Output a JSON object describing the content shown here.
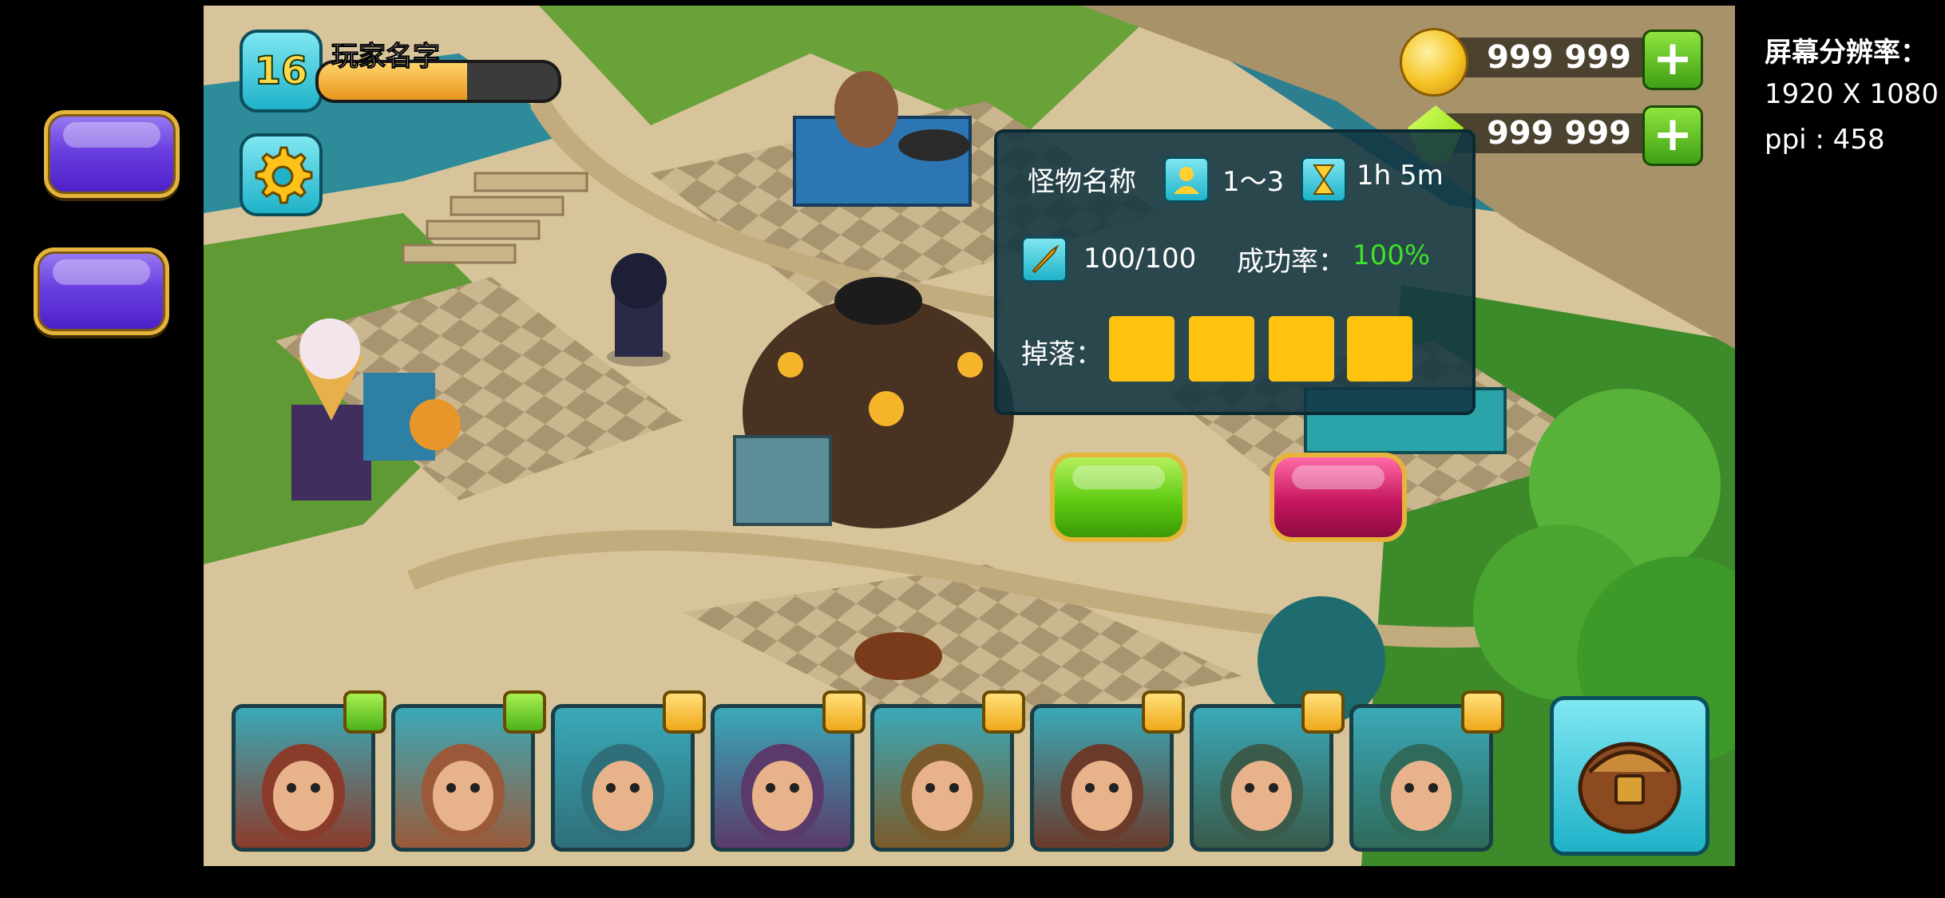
{
  "colors": {
    "side_button": "#6a3fe0",
    "button_border": "#e6b43a",
    "confirm_button": "#5ecb12",
    "cancel_button": "#c6165e",
    "drop_slot": "#ffc20e",
    "success_rate": "#3fe02a",
    "panel_bg": "#123642",
    "hud_teal": "#1fb2c9"
  },
  "device_info": {
    "resolution_label": "屏幕分辨率：",
    "resolution_value": "1920 X 1080",
    "ppi": "ppi : 458"
  },
  "player": {
    "level": "16",
    "name": "玩家名字",
    "xp_fraction": 0.62
  },
  "currencies": [
    {
      "icon": "gold-coin-icon",
      "value": "999 999"
    },
    {
      "icon": "green-gem-icon",
      "value": "999 999"
    }
  ],
  "monster_panel": {
    "name": "怪物名称",
    "players_icon": "player-icon",
    "players": "1～3",
    "time_icon": "hourglass-icon",
    "time": "1h 5m",
    "stamina_icon": "sword-icon",
    "stamina": "100/100",
    "success_label": "成功率：",
    "success_value": "100%",
    "drop_label": "掉落："
  },
  "portraits": [
    {
      "name": "pirate-red-bandana",
      "badge": "green"
    },
    {
      "name": "curly-hair-woman",
      "badge": "green"
    },
    {
      "name": "fox-ear-girl",
      "badge": "gold"
    },
    {
      "name": "red-hair-boy",
      "badge": "gold"
    },
    {
      "name": "caveman-one-eye",
      "badge": "gold"
    },
    {
      "name": "bearded-warrior",
      "badge": "gold"
    },
    {
      "name": "long-hair-hunter",
      "badge": "gold"
    },
    {
      "name": "green-lizard",
      "badge": "gold"
    }
  ]
}
